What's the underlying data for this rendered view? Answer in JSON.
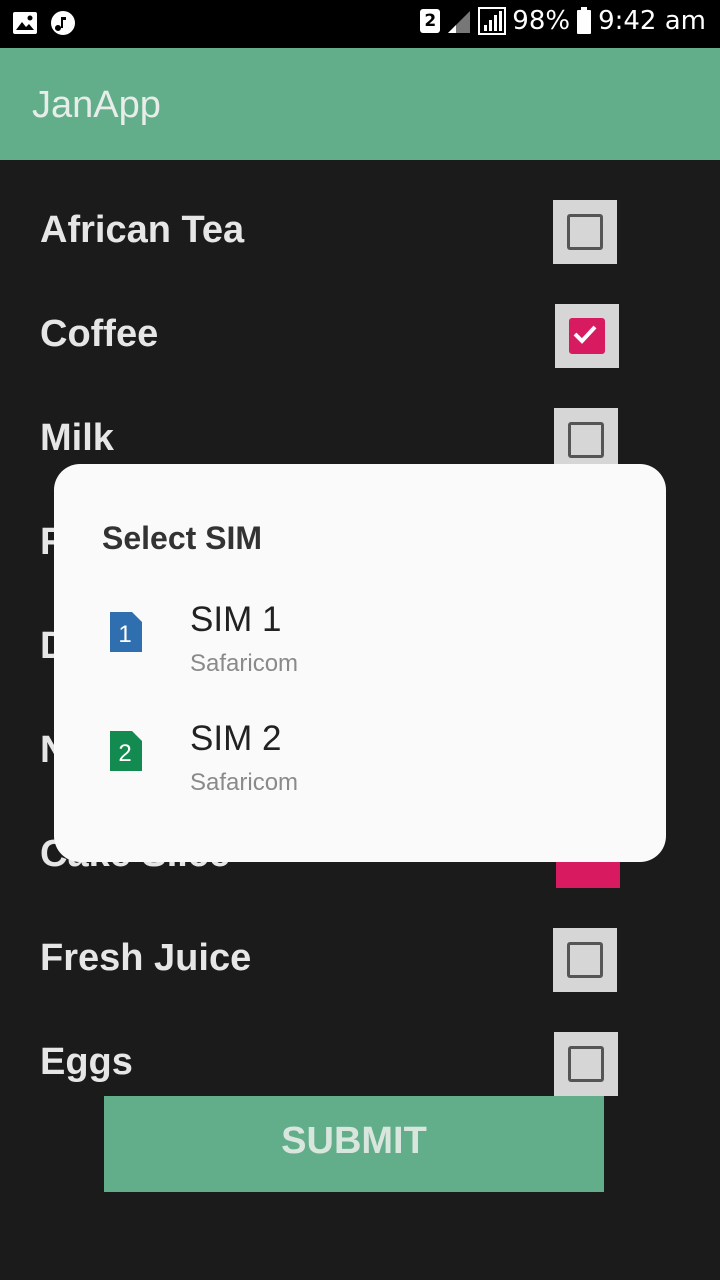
{
  "status": {
    "battery": "98%",
    "time": "9:42 am",
    "sim_badge": "2"
  },
  "app": {
    "title": "JanApp"
  },
  "items": [
    {
      "label": "African Tea",
      "checked": false
    },
    {
      "label": "Coffee",
      "checked": true
    },
    {
      "label": "Milk",
      "checked": false
    },
    {
      "label": "Fresh Juice",
      "checked": false
    },
    {
      "label": "Eggs",
      "checked": false
    }
  ],
  "submit_label": "SUBMIT",
  "dialog": {
    "title": "Select SIM",
    "sims": [
      {
        "name": "SIM 1",
        "carrier": "Safaricom",
        "number": "1",
        "color": "#2f6fb0"
      },
      {
        "name": "SIM 2",
        "carrier": "Safaricom",
        "number": "2",
        "color": "#138a4f"
      }
    ]
  }
}
